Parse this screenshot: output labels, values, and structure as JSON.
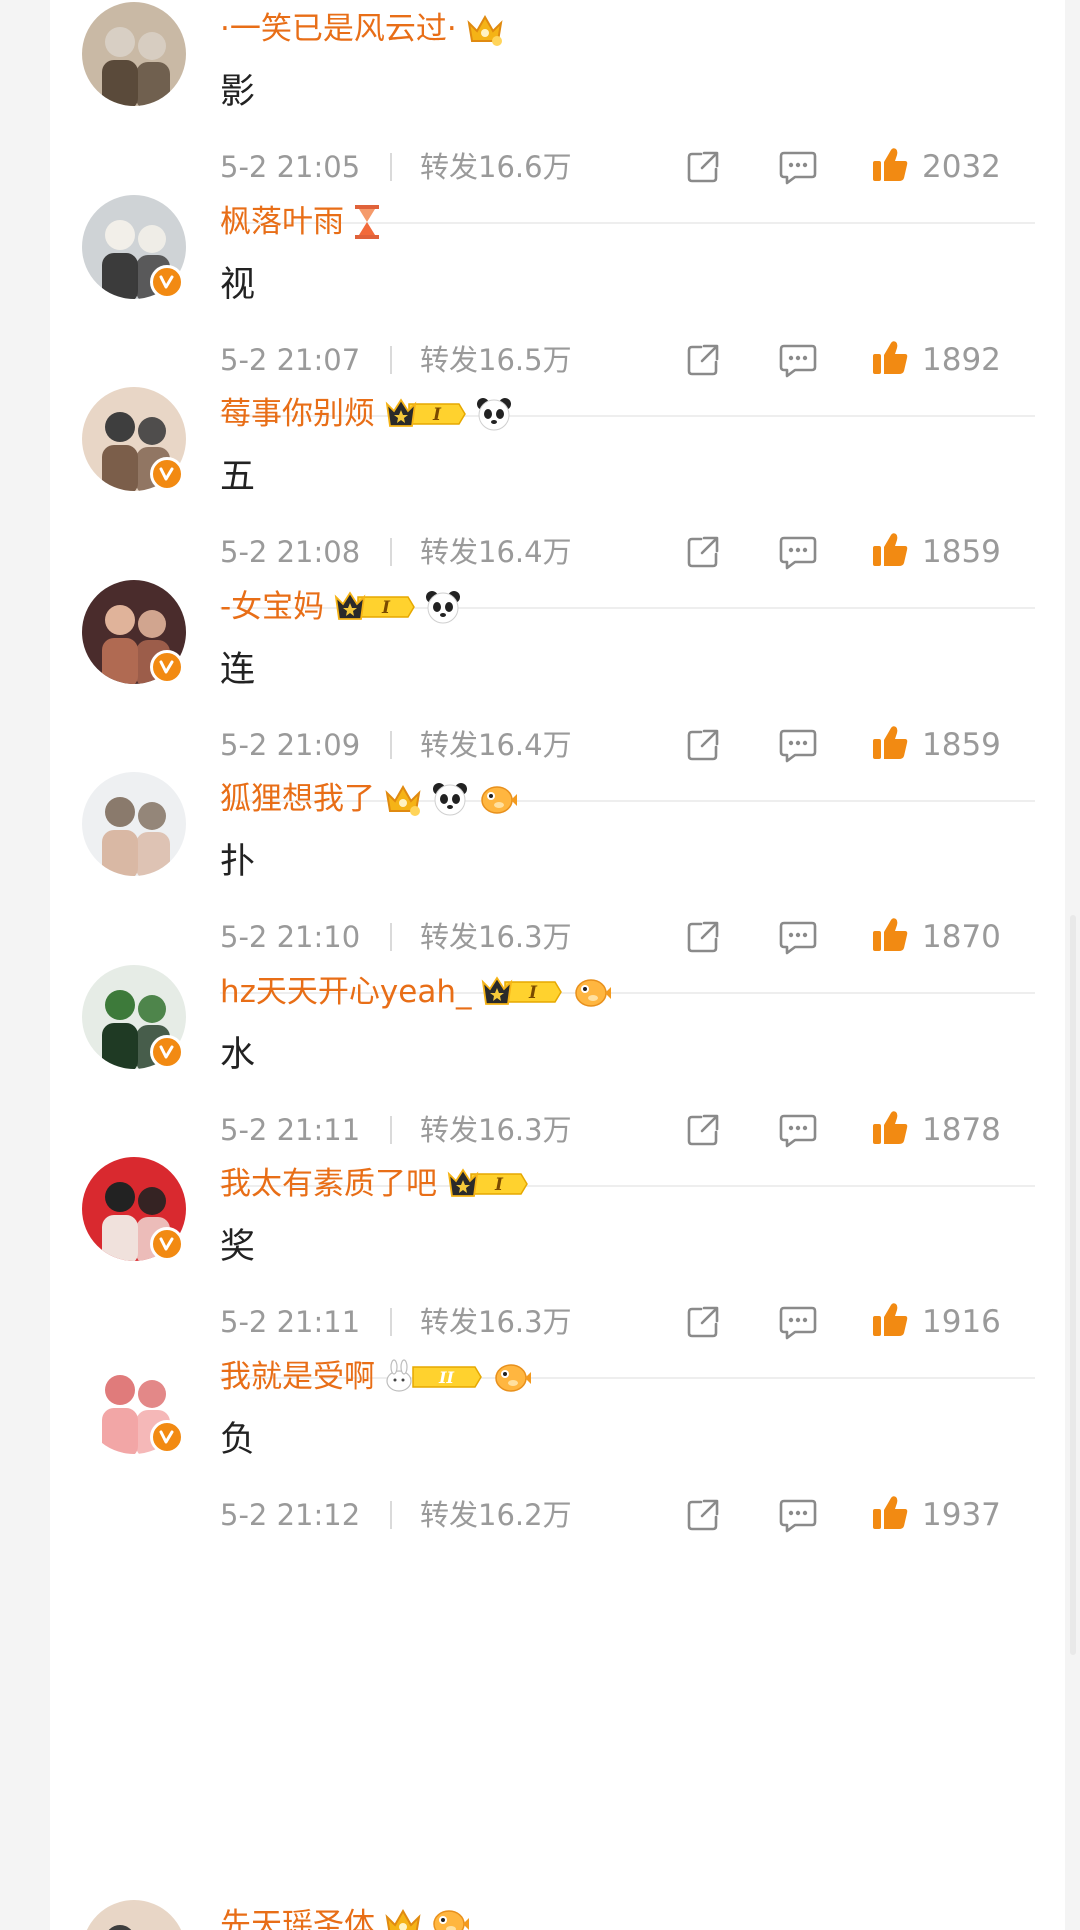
{
  "colors": {
    "username": "#e86e17",
    "verified": "#f28a12",
    "like": "#f28a12",
    "meta_text": "#9a9a9a",
    "content_text": "#222222"
  },
  "icons": {
    "share": "share-icon",
    "comment": "comment-bubble-icon",
    "like": "thumbs-up-icon",
    "verified": "verified-v-icon"
  },
  "comments": [
    {
      "username": "·一笑已是风云过·",
      "badges": [
        "crown-gold-icon"
      ],
      "text": "影",
      "time": "5-2 21:05",
      "repost": "转发16.6万",
      "likes": "2032",
      "verified": false
    },
    {
      "username": "枫落叶雨",
      "badges": [
        "hourglass-icon"
      ],
      "text": "视",
      "time": "5-2 21:07",
      "repost": "转发16.5万",
      "likes": "1892",
      "verified": true
    },
    {
      "username": "莓事你别烦",
      "badges": [
        "member-crown-level-icon",
        "panda-icon"
      ],
      "text": "五",
      "time": "5-2 21:08",
      "repost": "转发16.4万",
      "likes": "1859",
      "verified": true
    },
    {
      "username": "-女宝妈",
      "badges": [
        "member-crown-level-icon",
        "panda-icon"
      ],
      "text": "连",
      "time": "5-2 21:09",
      "repost": "转发16.4万",
      "likes": "1859",
      "verified": true
    },
    {
      "username": "狐狸想我了",
      "badges": [
        "crown-gold-icon",
        "panda-icon",
        "pufferfish-icon"
      ],
      "text": "扑",
      "time": "5-2 21:10",
      "repost": "转发16.3万",
      "likes": "1870",
      "verified": false
    },
    {
      "username": "hz天天开心yeah_",
      "badges": [
        "member-crown-level-icon",
        "pufferfish-icon"
      ],
      "text": "水",
      "time": "5-2 21:11",
      "repost": "转发16.3万",
      "likes": "1878",
      "verified": true
    },
    {
      "username": "我太有素质了吧",
      "badges": [
        "member-crown-level-icon"
      ],
      "text": "奖",
      "time": "5-2 21:11",
      "repost": "转发16.3万",
      "likes": "1916",
      "verified": true
    },
    {
      "username": "我就是受啊",
      "badges": [
        "bunny-level-icon",
        "pufferfish-icon"
      ],
      "text": "负",
      "time": "5-2 21:12",
      "repost": "转发16.2万",
      "likes": "1937",
      "verified": true
    }
  ],
  "partial_comment": {
    "username": "先天瑶圣体",
    "badges": [
      "crown-gold-icon",
      "pufferfish-icon"
    ]
  }
}
